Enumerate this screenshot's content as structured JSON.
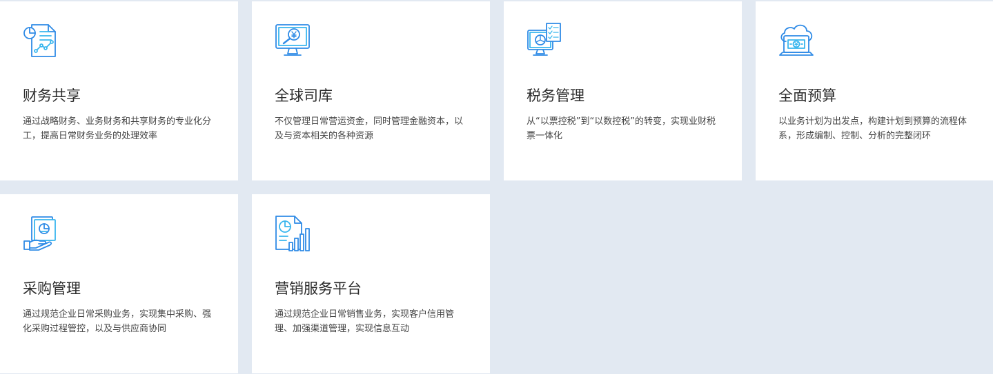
{
  "colors": {
    "page_background": "#e2e9f2",
    "card_background": "#ffffff",
    "icon_primary": "#2f8be6",
    "icon_accent": "#39b6ee"
  },
  "cards": [
    {
      "icon": "financial-report-icon",
      "title": "财务共享",
      "desc": "通过战略财务、业务财务和共享财务的专业化分工，提高日常财务业务的处理效率"
    },
    {
      "icon": "monitor-yuan-search-icon",
      "title": "全球司库",
      "desc": "不仅管理日常营运资金，同时管理金融资本，以及与资本相关的各种资源"
    },
    {
      "icon": "monitor-chart-checklist-icon",
      "title": "税务管理",
      "desc": "从“以票控税”到“以数控税”的转变，实现业财税票一体化"
    },
    {
      "icon": "cloud-laptop-yuan-icon",
      "title": "全面预算",
      "desc": "以业务计划为出发点，构建计划到预算的流程体系，形成编制、控制、分析的完整闭环"
    },
    {
      "icon": "hand-document-icon",
      "title": "采购管理",
      "desc": "通过规范企业日常采购业务，实现集中采购、强化采购过程管控，以及与供应商协同"
    },
    {
      "icon": "document-bar-chart-icon",
      "title": "营销服务平台",
      "desc": "通过规范企业日常销售业务，实现客户信用管理、加强渠道管理，实现信息互动"
    }
  ]
}
